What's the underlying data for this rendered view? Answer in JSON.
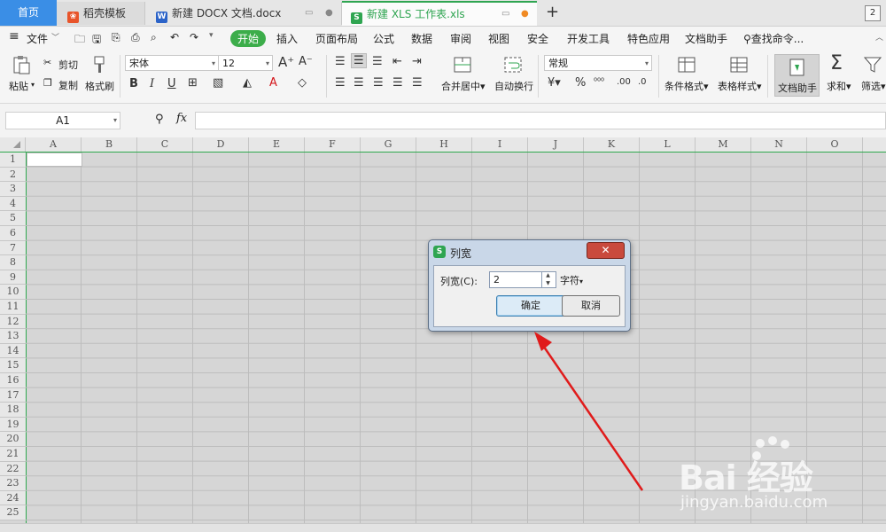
{
  "tabs": {
    "home": "首页",
    "daoke": "稻壳模板",
    "docx": "新建 DOCX 文档.docx",
    "xls": "新建 XLS 工作表.xls",
    "count": "2"
  },
  "menu": [
    "文件",
    "开始",
    "插入",
    "页面布局",
    "公式",
    "数据",
    "审阅",
    "视图",
    "安全",
    "开发工具",
    "特色应用",
    "文档助手"
  ],
  "search": {
    "label": "查找命令..."
  },
  "ribbon": {
    "paste": "粘贴",
    "cut": "剪切",
    "copy": "复制",
    "format_painter": "格式刷",
    "font_name": "宋体",
    "font_size": "12",
    "merge_center": "合并居中",
    "wrap_text": "自动换行",
    "number_format": "常规",
    "conditional_format": "条件格式",
    "table_style": "表格样式",
    "doc_assistant": "文档助手",
    "sum": "求和",
    "filter": "筛选"
  },
  "formula_bar": {
    "name_box": "A1",
    "fx": "fx",
    "value": ""
  },
  "grid": {
    "columns": [
      "A",
      "B",
      "C",
      "D",
      "E",
      "F",
      "G",
      "H",
      "I",
      "J",
      "K",
      "L",
      "M",
      "N",
      "O"
    ],
    "rows": [
      "1",
      "2",
      "3",
      "4",
      "5",
      "6",
      "7",
      "8",
      "9",
      "10",
      "11",
      "12",
      "13",
      "14",
      "15",
      "16",
      "17",
      "18",
      "19",
      "20",
      "21",
      "22",
      "23",
      "24",
      "25"
    ]
  },
  "dialog": {
    "title": "列宽",
    "field_label": "列宽(C):",
    "field_value": "2",
    "unit": "字符",
    "ok": "确定",
    "cancel": "取消"
  },
  "watermark": {
    "logo": "Bai 经验",
    "url": "jingyan.baidu.com"
  },
  "colors": {
    "accent_green": "#2fa551",
    "home_tab_blue": "#3a8ee6",
    "arrow_red": "#e01b1b"
  }
}
